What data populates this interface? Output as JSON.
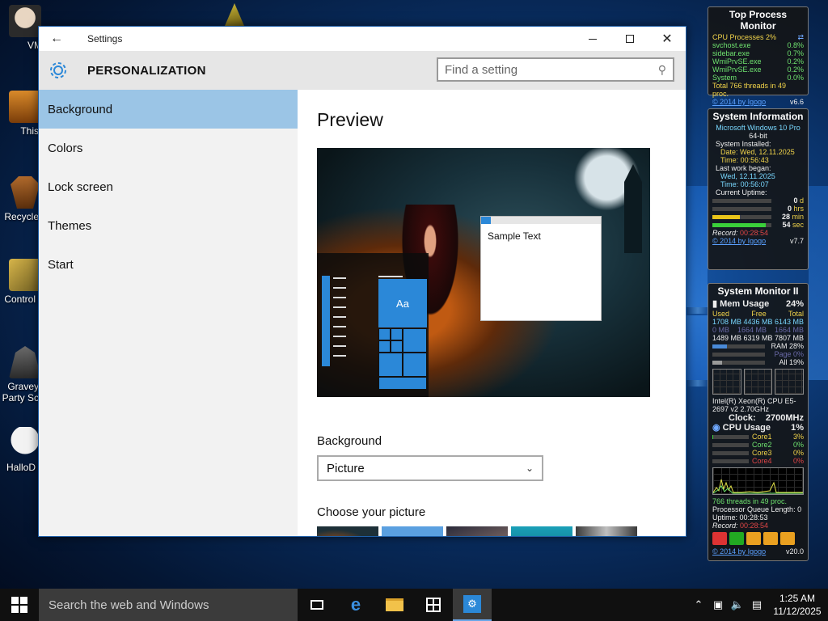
{
  "desktop": {
    "icons": [
      {
        "label": "VM"
      },
      {
        "label": "This"
      },
      {
        "label": "Recycle"
      },
      {
        "label": "Control"
      },
      {
        "label": "Gravey",
        "label2": "Party Sc"
      },
      {
        "label": "HalloD"
      }
    ]
  },
  "window": {
    "title": "Settings",
    "section": "PERSONALIZATION",
    "search_placeholder": "Find a setting",
    "nav": [
      {
        "label": "Background"
      },
      {
        "label": "Colors"
      },
      {
        "label": "Lock screen"
      },
      {
        "label": "Themes"
      },
      {
        "label": "Start"
      }
    ],
    "preview_title": "Preview",
    "preview_tile": "Aa",
    "preview_sample": "Sample Text",
    "background_label": "Background",
    "background_value": "Picture",
    "choose_label": "Choose your picture"
  },
  "top_process_monitor": {
    "title": "Top Process Monitor",
    "header": "CPU Processes 2%",
    "processes": [
      {
        "name": "svchost.exe",
        "val": "0.8%"
      },
      {
        "name": "sidebar.exe",
        "val": "0.7%"
      },
      {
        "name": "WmiPrvSE.exe",
        "val": "0.2%"
      },
      {
        "name": "WmiPrvSE.exe",
        "val": "0.2%"
      },
      {
        "name": "System",
        "val": "0.0%"
      }
    ],
    "total": "Total 766 threads in 49 proc.",
    "credit": "© 2014 by Igogo",
    "version": "v6.6"
  },
  "system_information": {
    "title": "System Information",
    "os": "Microsoft Windows 10 Pro",
    "arch": "64-bit",
    "installed_label": "System Installed:",
    "installed_date": "Date: Wed, 12.11.2025",
    "installed_time": "Time: 00:56:43",
    "lastwork_label": "Last work began:",
    "lastwork_date": "Wed, 12.11.2025",
    "lastwork_time": "Time: 00:56:07",
    "uptime_label": "Current Uptime:",
    "uptime": [
      {
        "value": "0",
        "unit": "d",
        "fill": 0
      },
      {
        "value": "0",
        "unit": "hrs",
        "fill": 0
      },
      {
        "value": "28",
        "unit": "min",
        "fill": 0.47
      },
      {
        "value": "54",
        "unit": "sec",
        "fill": 0.9
      }
    ],
    "record_label": "Record:",
    "record_value": "00:28:54",
    "credit": "© 2014 by Igogo",
    "version": "v7.7"
  },
  "system_monitor": {
    "title": "System Monitor II",
    "mem_label": "Mem Usage",
    "mem_pct": "24%",
    "cols": [
      "Used",
      "Free",
      "Total"
    ],
    "rows": [
      [
        "1708 MB",
        "4436 MB",
        "6143 MB"
      ],
      [
        "0 MB",
        "1664 MB",
        "1664 MB"
      ],
      [
        "1489 MB",
        "6319 MB",
        "7807 MB"
      ]
    ],
    "ram": {
      "label": "RAM",
      "pct": "28%",
      "fill": 0.28
    },
    "page": {
      "label": "Page",
      "pct": "0%",
      "fill": 0
    },
    "all": {
      "label": "All",
      "pct": "19%",
      "fill": 0.19
    },
    "cpu_name": "Intel(R) Xeon(R) CPU E5-2697 v2 2.70GHz",
    "clock_label": "Clock:",
    "clock_value": "2700MHz",
    "cpu_label": "CPU Usage",
    "cpu_pct": "1%",
    "cores": [
      {
        "label": "Core1",
        "pct": "3%",
        "fill": 0.03
      },
      {
        "label": "Core2",
        "pct": "0%",
        "fill": 0
      },
      {
        "label": "Core3",
        "pct": "0%",
        "fill": 0
      },
      {
        "label": "Core4",
        "pct": "0%",
        "fill": 0
      }
    ],
    "threads": "766 threads in 49 proc.",
    "queue": "Processor Queue Length: 0",
    "uptime": "Uptime: 00:28:53",
    "record": "Record:",
    "record_value": "00:28:54",
    "credit": "© 2014 by Igogo",
    "version": "v20.0"
  },
  "taskbar": {
    "search": "Search the web and Windows",
    "time": "1:25 AM",
    "date": "11/12/2025"
  },
  "colors": {
    "accent": "#2b88d8",
    "nav_selected": "#9bc5e6"
  }
}
